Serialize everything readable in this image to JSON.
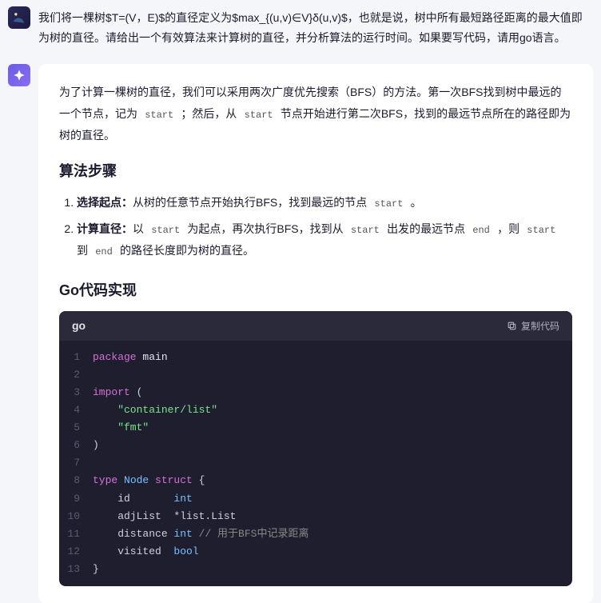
{
  "user": {
    "text": "我们将一棵树$T=(V，E)$的直径定义为$max_{(u,v)∈V}δ(u,v)$，也就是说，树中所有最短路径距离的最大值即为树的直径。请给出一个有效算法来计算树的直径，并分析算法的运行时间。如果要写代码，请用go语言。"
  },
  "assistant": {
    "intro_pre": "为了计算一棵树的直径，我们可以采用两次广度优先搜索（BFS）的方法。第一次BFS找到树中最远的一个节点，记为",
    "intro_c1": " start ",
    "intro_mid1": "；然后，从",
    "intro_c2": " start ",
    "intro_post": "节点开始进行第二次BFS，找到的最远节点所在的路径即为树的直径。",
    "h_steps": "算法步骤",
    "step1_label": "选择起点：",
    "step1_text": "从树的任意节点开始执行BFS，找到最远的节点",
    "step1_c1": " start ",
    "step1_end": "。",
    "step2_label": "计算直径：",
    "step2_t1": "以",
    "step2_c1": " start ",
    "step2_t2": "为起点，再次执行BFS，找到从",
    "step2_c2": " start ",
    "step2_t3": "出发的最远节点",
    "step2_c3": " end ",
    "step2_t4": "，则",
    "step2_c4": " start ",
    "step2_t5": "到",
    "step2_c5": " end ",
    "step2_t6": "的路径长度即为树的直径。",
    "h_code": "Go代码实现",
    "code_lang": "go",
    "copy_label": "复制代码",
    "code": {
      "l1": {
        "a": "package ",
        "b": "main"
      },
      "l2": "",
      "l3": {
        "a": "import ",
        "b": "("
      },
      "l4": "    \"container/list\"",
      "l5": "    \"fmt\"",
      "l6": ")",
      "l7": "",
      "l8": {
        "a": "type ",
        "b": "Node ",
        "c": "struct ",
        "d": "{"
      },
      "l9": {
        "a": "    id       ",
        "b": "int"
      },
      "l10": {
        "a": "    adjList  *list.List"
      },
      "l11": {
        "a": "    distance ",
        "b": "int ",
        "c": "// 用于BFS中记录距离"
      },
      "l12": {
        "a": "    visited  ",
        "b": "bool"
      },
      "l13": "}"
    }
  }
}
